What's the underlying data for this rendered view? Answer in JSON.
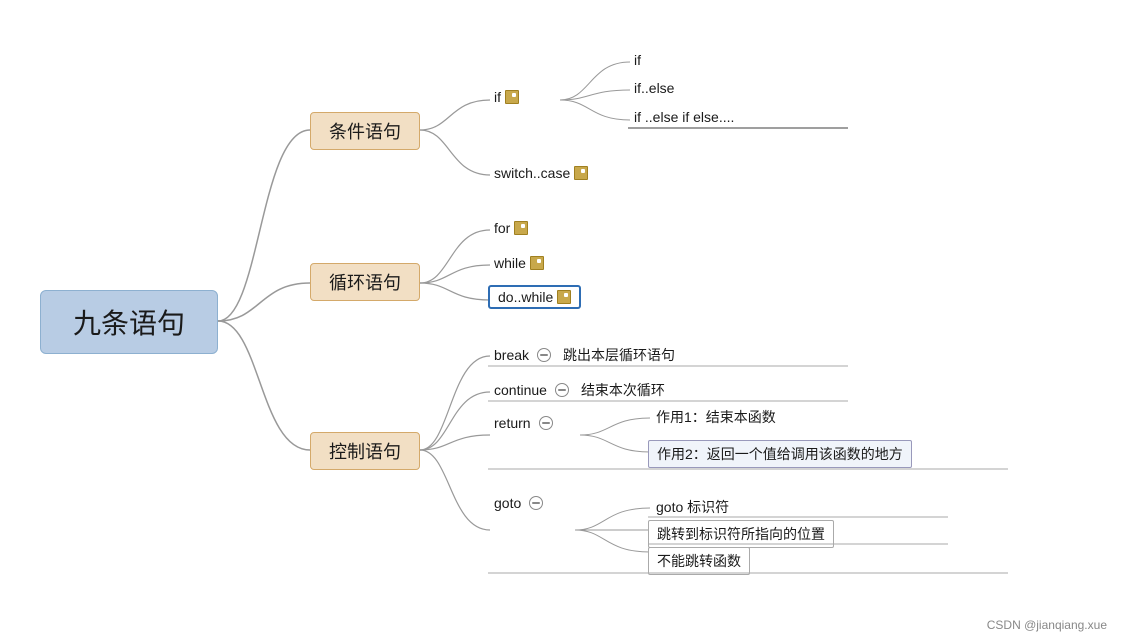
{
  "diagram": {
    "title": "九条语句",
    "categories": [
      {
        "label": "条件语句",
        "id": "cat-conditional"
      },
      {
        "label": "循环语句",
        "id": "cat-loop"
      },
      {
        "label": "控制语句",
        "id": "cat-control"
      }
    ],
    "conditional": {
      "if_group": {
        "label": "if",
        "icon": "note",
        "children": [
          "if",
          "if..else",
          "if ..else if else...."
        ]
      },
      "switchcase": {
        "label": "switch..case",
        "icon": "note"
      }
    },
    "loop": {
      "for": {
        "label": "for",
        "icon": "note"
      },
      "while": {
        "label": "while",
        "icon": "note"
      },
      "dowhile": {
        "label": "do..while",
        "icon": "note",
        "highlighted": true
      }
    },
    "control": {
      "break": {
        "label": "break",
        "icon": "minus",
        "desc": "跳出本层循环语句"
      },
      "continue": {
        "label": "continue",
        "icon": "minus",
        "desc": "结束本次循环"
      },
      "return": {
        "label": "return",
        "icon": "minus",
        "children": [
          "作用1：结束本函数",
          "作用2：返回一个值给调用该函数的地方"
        ]
      },
      "goto": {
        "label": "goto",
        "icon": "minus",
        "children": [
          "goto 标识符",
          "跳转到标识符所指向的位置",
          "不能跳转函数"
        ]
      }
    },
    "watermark": "CSDN @jianqiang.xue"
  }
}
